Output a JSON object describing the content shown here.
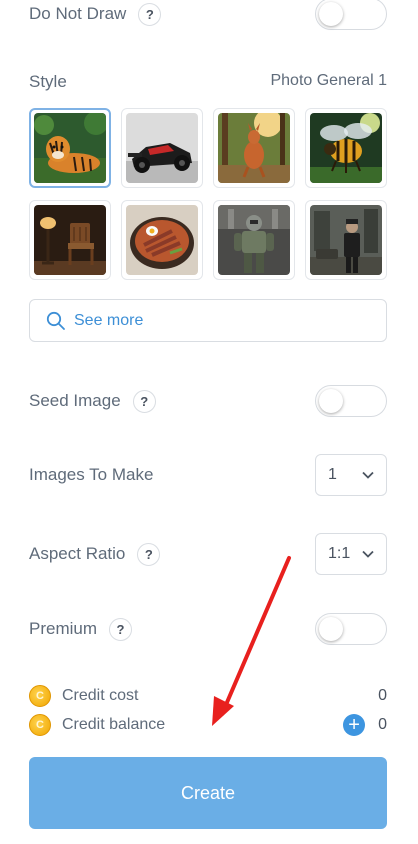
{
  "do_not_draw": {
    "label": "Do Not Draw",
    "help": "?",
    "enabled": false
  },
  "style": {
    "label": "Style",
    "selected": "Photo General 1",
    "thumbnails": [
      {
        "name": "tiger",
        "selected": true
      },
      {
        "name": "race-car",
        "selected": false
      },
      {
        "name": "kangaroo",
        "selected": false
      },
      {
        "name": "bee",
        "selected": false
      },
      {
        "name": "chair-lamp",
        "selected": false
      },
      {
        "name": "ramen-bowl",
        "selected": false
      },
      {
        "name": "robot-soldier",
        "selected": false
      },
      {
        "name": "man-in-ruins",
        "selected": false
      }
    ],
    "see_more": "See more",
    "see_more_icon": "search-icon"
  },
  "seed_image": {
    "label": "Seed Image",
    "help": "?",
    "enabled": false
  },
  "images_to_make": {
    "label": "Images To Make",
    "value": "1"
  },
  "aspect_ratio": {
    "label": "Aspect Ratio",
    "help": "?",
    "value": "1:1"
  },
  "premium": {
    "label": "Premium",
    "help": "?",
    "enabled": false
  },
  "credits": {
    "cost_label": "Credit cost",
    "cost_value": "0",
    "balance_label": "Credit balance",
    "balance_value": "0",
    "coin_glyph": "C",
    "add_glyph": "+"
  },
  "create_button": "Create",
  "colors": {
    "accent": "#3d95e0",
    "create_bg": "#6aaee6",
    "arrow": "#e8201e",
    "text": "#5f6b7a"
  }
}
